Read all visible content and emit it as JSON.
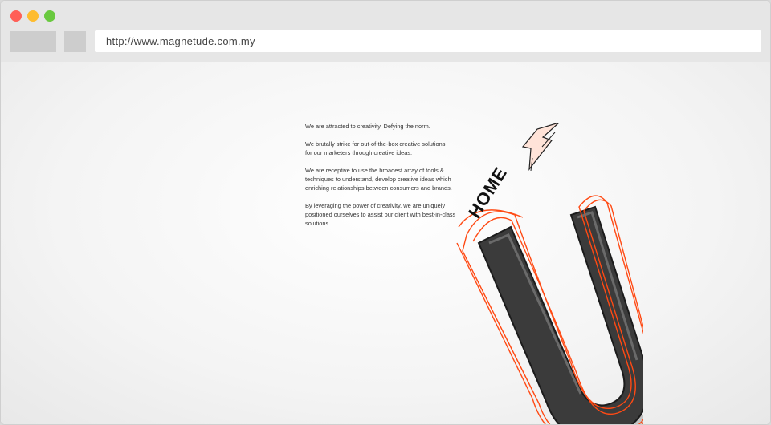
{
  "browser": {
    "url": "http://www.magnetude.com.my"
  },
  "content": {
    "paragraphs": [
      "We are attracted to creativity. Defying the norm.",
      "We brutally strike for out-of-the-box creative solutions\nfor our marketers through creative ideas.",
      "We are receptive to use the broadest array of tools &\ntechniques to understand, develop creative ideas which\nenriching relationships between consumers and brands.",
      "By leveraging the power of creativity, we are uniquely\npositioned ourselves to assist our client with best-in-class\nsolutions."
    ],
    "home_label": "HOME"
  },
  "colors": {
    "accent": "#ff4a14",
    "magnet": "#3a3a3a"
  },
  "icons": {
    "magnet": "magnet-icon",
    "lightning": "lightning-bolt-icon"
  }
}
